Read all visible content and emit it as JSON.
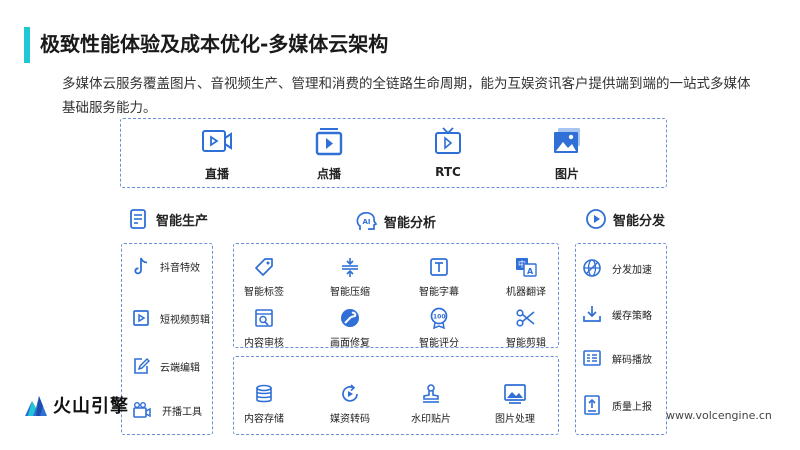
{
  "header": {
    "title": "极致性能体验及成本优化-多媒体云架构",
    "description": "多媒体云服务覆盖图片、音视频生产、管理和消费的全链路生命周期，能为互娱资讯客户提供端到端的一站式多媒体基础服务能力。",
    "accent_color": "#22c7d6"
  },
  "media_types": [
    {
      "label": "直播",
      "icon": "live-video-icon"
    },
    {
      "label": "点播",
      "icon": "vod-play-icon"
    },
    {
      "label": "RTC",
      "icon": "rtc-tv-icon"
    },
    {
      "label": "图片",
      "icon": "image-icon"
    }
  ],
  "sections": {
    "production": {
      "title": "智能生产",
      "icon": "document-edit-icon",
      "items": [
        {
          "label": "抖音特效",
          "icon": "tiktok-icon"
        },
        {
          "label": "短视频剪辑",
          "icon": "video-edit-icon"
        },
        {
          "label": "云端编辑",
          "icon": "pencil-edit-icon"
        },
        {
          "label": "开播工具",
          "icon": "camera-icon"
        }
      ]
    },
    "analysis": {
      "title": "智能分析",
      "icon": "ai-head-icon",
      "items": [
        {
          "label": "智能标签",
          "icon": "tag-icon"
        },
        {
          "label": "智能压缩",
          "icon": "compress-icon"
        },
        {
          "label": "智能字幕",
          "icon": "subtitle-icon"
        },
        {
          "label": "机器翻译",
          "icon": "translate-icon"
        },
        {
          "label": "内容审核",
          "icon": "review-icon"
        },
        {
          "label": "画面修复",
          "icon": "repair-icon"
        },
        {
          "label": "智能评分",
          "icon": "score-icon"
        },
        {
          "label": "智能剪辑",
          "icon": "scissors-icon"
        }
      ]
    },
    "storage": {
      "items": [
        {
          "label": "内容存储",
          "icon": "database-icon"
        },
        {
          "label": "媒资转码",
          "icon": "transcode-icon"
        },
        {
          "label": "水印贴片",
          "icon": "stamp-icon"
        },
        {
          "label": "图片处理",
          "icon": "picture-process-icon"
        }
      ]
    },
    "distribution": {
      "title": "智能分发",
      "icon": "play-circle-icon",
      "items": [
        {
          "label": "分发加速",
          "icon": "globe-icon"
        },
        {
          "label": "缓存策略",
          "icon": "download-icon"
        },
        {
          "label": "解码播放",
          "icon": "decode-icon"
        },
        {
          "label": "质量上报",
          "icon": "upload-report-icon"
        }
      ]
    }
  },
  "footer": {
    "brand": "火山引擎",
    "url": "www.volcengine.cn"
  }
}
